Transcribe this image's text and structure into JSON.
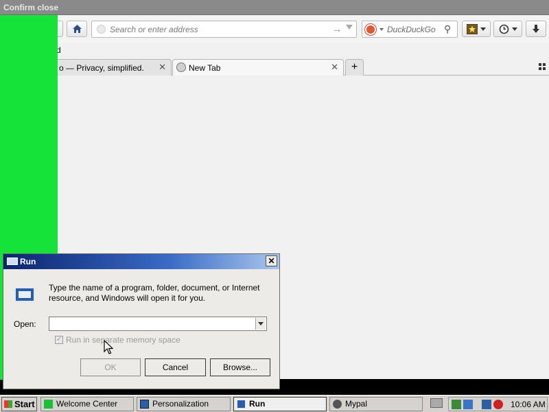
{
  "confirm_close": {
    "title": "Confirm close"
  },
  "browser": {
    "url_placeholder": "Search or enter address",
    "search_engine": "DuckDuckGo",
    "bookmark_partial": "d",
    "tabs": [
      {
        "title": "o — Privacy, simplified."
      },
      {
        "title": "New Tab"
      }
    ],
    "new_tab_symbol": "+",
    "tab_close_symbol": "✕"
  },
  "run_dialog": {
    "title": "Run",
    "close_symbol": "✕",
    "description": "Type the name of a program, folder, document, or Internet resource, and Windows will open it for you.",
    "open_label": "Open:",
    "open_value": "",
    "checkbox_label": "Run in separate memory space",
    "checkbox_checked": true,
    "ok_label": "OK",
    "cancel_label": "Cancel",
    "browse_label": "Browse..."
  },
  "taskbar": {
    "start_label": "Start",
    "tasks": [
      {
        "label": "Welcome Center",
        "icon": "welcome-center-icon"
      },
      {
        "label": "Personalization",
        "icon": "personalization-icon"
      },
      {
        "label": "Run",
        "icon": "run-icon",
        "active": true
      },
      {
        "label": "Mypal",
        "icon": "mypal-icon"
      }
    ],
    "clock": "10:06 AM"
  },
  "colors": {
    "green_strip": "#16e33a",
    "title_gradient_start": "#0b2470",
    "title_gradient_end": "#a9c6ec"
  }
}
